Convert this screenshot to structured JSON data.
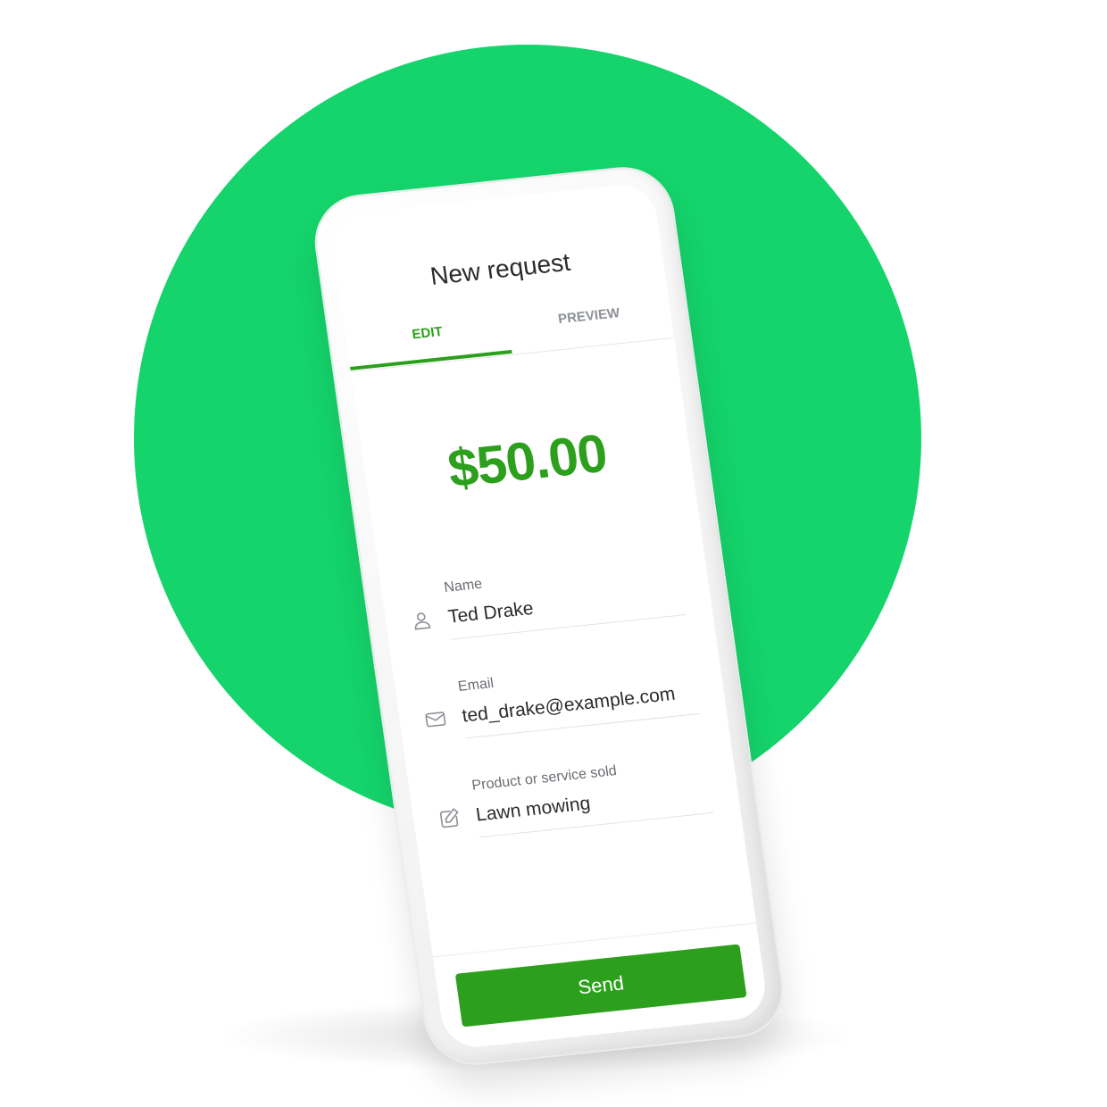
{
  "colors": {
    "background_circle": "#14d46b",
    "accent": "#2ca01c",
    "inactive_tab": "#8d9096",
    "text": "#2b2b2b",
    "label": "#6b6c72"
  },
  "header": {
    "title": "New request"
  },
  "tabs": [
    {
      "label": "EDIT",
      "active": true
    },
    {
      "label": "PREVIEW",
      "active": false
    }
  ],
  "amount": "$50.00",
  "form": {
    "name": {
      "label": "Name",
      "value": "Ted Drake",
      "icon": "person-icon"
    },
    "email": {
      "label": "Email",
      "value": "ted_drake@example.com",
      "icon": "envelope-icon"
    },
    "product": {
      "label": "Product or service sold",
      "value": "Lawn mowing",
      "icon": "edit-icon"
    }
  },
  "send_label": "Send"
}
